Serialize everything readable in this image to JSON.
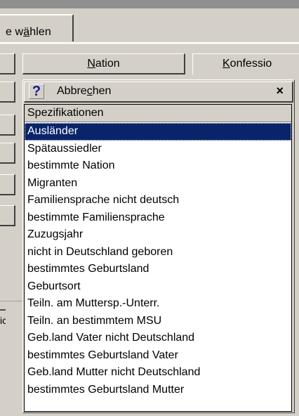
{
  "tab": {
    "label_pre": "e w",
    "label_mnemonic": "ä",
    "label_post": "hlen"
  },
  "buttons": {
    "nation": {
      "mnemonic": "N",
      "rest": "ation"
    },
    "konfession": {
      "mnemonic": "K",
      "rest": "onfessio"
    }
  },
  "dropdown": {
    "help_glyph": "?",
    "cancel": {
      "pre": "Abbre",
      "mnemonic": "c",
      "post": "hen"
    },
    "close_glyph": "×",
    "header": "Spezifikationen",
    "selected_index": 0,
    "items": [
      "Ausländer",
      "Spätaussiedler",
      "bestimmte Nation",
      "Migranten",
      "Familiensprache nicht deutsch",
      "bestimmte Familiensprache",
      "Zuzugsjahr",
      "nicht in Deutschland geboren",
      "bestimmtes Geburtsland",
      "Geburtsort",
      "Teiln. am Muttersp.-Unterr.",
      "Teiln. an bestimmtem MSU",
      "Geb.land Vater nicht Deutschland",
      "bestimmtes Geburtsland Vater",
      "Geb.land Mutter nicht Deutschland",
      "bestimmtes Geburtsland Mutter"
    ]
  },
  "left_fragment": {
    "text": "ic"
  }
}
